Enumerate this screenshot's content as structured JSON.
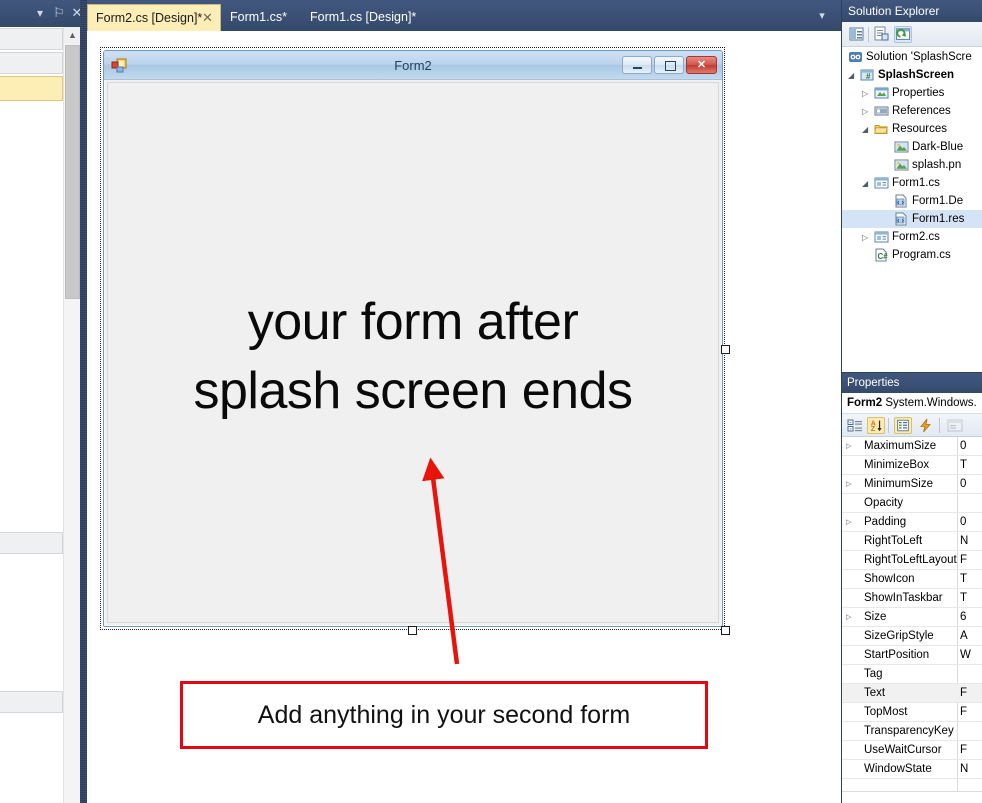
{
  "left_panel": {
    "header_buttons": [
      {
        "name": "dropdown",
        "glyph": "▾"
      },
      {
        "name": "pin",
        "glyph": "⚐"
      },
      {
        "name": "close",
        "glyph": "✕"
      }
    ],
    "scroll_up_glyph": "▲"
  },
  "tabs": {
    "active": {
      "label": "Form2.cs [Design]*",
      "close_glyph": "✕"
    },
    "others": [
      {
        "label": "Form1.cs*"
      },
      {
        "label": "Form1.cs [Design]*"
      }
    ],
    "dropdown_glyph": "▾"
  },
  "form": {
    "title": "Form2",
    "body_line1": "your form after",
    "body_line2": "splash screen ends",
    "buttons": {
      "minimize": "minimize",
      "maximize": "maximize",
      "close_glyph": "✕"
    }
  },
  "annotation": {
    "callout_text": "Add anything in your second form",
    "accent_color": "#e30613"
  },
  "solution_explorer": {
    "title": "Solution Explorer",
    "toolbar": [
      {
        "name": "properties-window-icon"
      },
      {
        "name": "show-all-files-icon"
      },
      {
        "name": "refresh-icon"
      }
    ],
    "tree": [
      {
        "label": "Solution 'SplashScre",
        "icon": "solution-icon",
        "indent": 6,
        "expander": "",
        "bold": false,
        "selected": false
      },
      {
        "label": "SplashScreen",
        "icon": "csproject-icon",
        "indent": 18,
        "expander": "◢",
        "bold": true,
        "selected": false
      },
      {
        "label": "Properties",
        "icon": "properties-folder-icon",
        "indent": 32,
        "expander": "▷",
        "bold": false,
        "selected": false
      },
      {
        "label": "References",
        "icon": "references-icon",
        "indent": 32,
        "expander": "▷",
        "bold": false,
        "selected": false
      },
      {
        "label": "Resources",
        "icon": "folder-icon",
        "indent": 32,
        "expander": "◢",
        "bold": false,
        "selected": false
      },
      {
        "label": "Dark-Blue",
        "icon": "image-icon",
        "indent": 52,
        "expander": "",
        "bold": false,
        "selected": false
      },
      {
        "label": "splash.pn",
        "icon": "image-icon",
        "indent": 52,
        "expander": "",
        "bold": false,
        "selected": false
      },
      {
        "label": "Form1.cs",
        "icon": "form-icon",
        "indent": 32,
        "expander": "◢",
        "bold": false,
        "selected": false
      },
      {
        "label": "Form1.De",
        "icon": "code-file-icon",
        "indent": 52,
        "expander": "",
        "bold": false,
        "selected": false
      },
      {
        "label": "Form1.res",
        "icon": "code-file-icon",
        "indent": 52,
        "expander": "",
        "bold": false,
        "selected": true
      },
      {
        "label": "Form2.cs",
        "icon": "form-icon",
        "indent": 32,
        "expander": "▷",
        "bold": false,
        "selected": false
      },
      {
        "label": "Program.cs",
        "icon": "cs-file-icon",
        "indent": 32,
        "expander": "",
        "bold": false,
        "selected": false
      }
    ]
  },
  "properties": {
    "title": "Properties",
    "object_name": "Form2",
    "object_type": "System.Windows.",
    "toolbar": [
      {
        "name": "categorized-icon"
      },
      {
        "name": "alphabetical-icon"
      },
      {
        "name": "properties-icon"
      },
      {
        "name": "events-icon"
      },
      {
        "name": "property-pages-icon"
      }
    ],
    "rows": [
      {
        "name": "MaximumSize",
        "value": "0",
        "expander": "▷"
      },
      {
        "name": "MinimizeBox",
        "value": "T",
        "expander": ""
      },
      {
        "name": "MinimumSize",
        "value": "0",
        "expander": "▷"
      },
      {
        "name": "Opacity",
        "value": "",
        "expander": ""
      },
      {
        "name": "Padding",
        "value": "0",
        "expander": "▷"
      },
      {
        "name": "RightToLeft",
        "value": "N",
        "expander": ""
      },
      {
        "name": "RightToLeftLayout",
        "value": "F",
        "expander": ""
      },
      {
        "name": "ShowIcon",
        "value": "T",
        "expander": ""
      },
      {
        "name": "ShowInTaskbar",
        "value": "T",
        "expander": ""
      },
      {
        "name": "Size",
        "value": "6",
        "expander": "▷"
      },
      {
        "name": "SizeGripStyle",
        "value": "A",
        "expander": ""
      },
      {
        "name": "StartPosition",
        "value": "W",
        "expander": ""
      },
      {
        "name": "Tag",
        "value": "",
        "expander": ""
      },
      {
        "name": "Text",
        "value": "F",
        "expander": ""
      },
      {
        "name": "TopMost",
        "value": "F",
        "expander": ""
      },
      {
        "name": "TransparencyKey",
        "value": "",
        "expander": ""
      },
      {
        "name": "UseWaitCursor",
        "value": "F",
        "expander": ""
      },
      {
        "name": "WindowState",
        "value": "N",
        "expander": ""
      }
    ]
  }
}
